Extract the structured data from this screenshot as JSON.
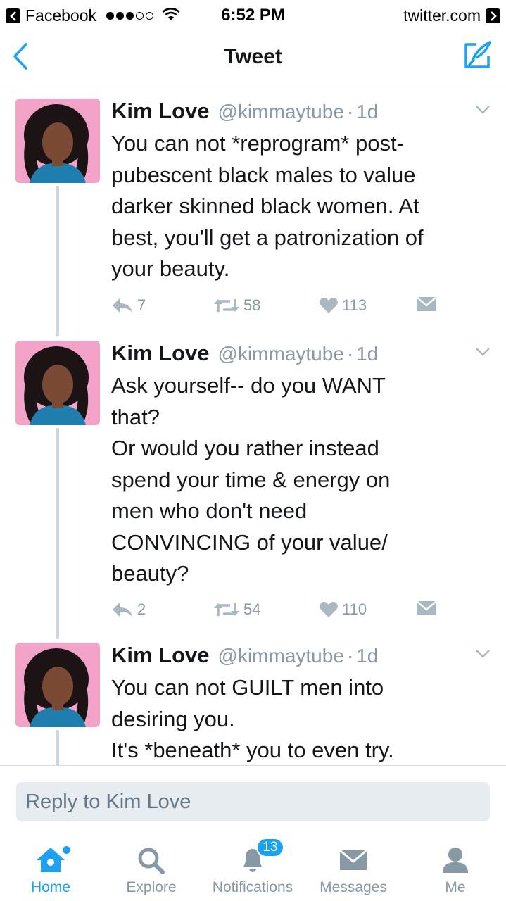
{
  "status_bar": {
    "back_app": "Facebook",
    "time": "6:52 PM",
    "domain": "twitter.com"
  },
  "nav": {
    "title": "Tweet"
  },
  "tweets": [
    {
      "name": "Kim Love",
      "handle": "@kimmaytube",
      "separator": "·",
      "time": "1d",
      "lines": [
        "You can not *reprogram* post-",
        "pubescent black males to value",
        "darker skinned black women. At",
        "best, you'll get a patronization of",
        "your beauty."
      ],
      "replies": "7",
      "retweets": "58",
      "likes": "113"
    },
    {
      "name": "Kim Love",
      "handle": "@kimmaytube",
      "separator": "·",
      "time": "1d",
      "lines": [
        "Ask yourself-- do you WANT",
        "that?",
        "Or would you rather instead",
        "spend your time & energy on",
        "men who don't need",
        "CONVINCING of your value/",
        "beauty?"
      ],
      "replies": "2",
      "retweets": "54",
      "likes": "110"
    },
    {
      "name": "Kim Love",
      "handle": "@kimmaytube",
      "separator": "·",
      "time": "1d",
      "lines": [
        "You can not GUILT men into",
        "desiring you.",
        "It's *beneath* you to even try."
      ]
    }
  ],
  "reply": {
    "placeholder": "Reply to Kim Love"
  },
  "tabs": [
    {
      "label": "Home",
      "icon": "home-icon",
      "active": true
    },
    {
      "label": "Explore",
      "icon": "search-icon"
    },
    {
      "label": "Notifications",
      "icon": "bell-icon",
      "badge": "13"
    },
    {
      "label": "Messages",
      "icon": "envelope-icon"
    },
    {
      "label": "Me",
      "icon": "person-icon"
    }
  ],
  "colors": {
    "accent": "#1da1f2",
    "muted": "#8899a6",
    "text": "#14171a",
    "avatar_bg": "#f4a3c8"
  }
}
